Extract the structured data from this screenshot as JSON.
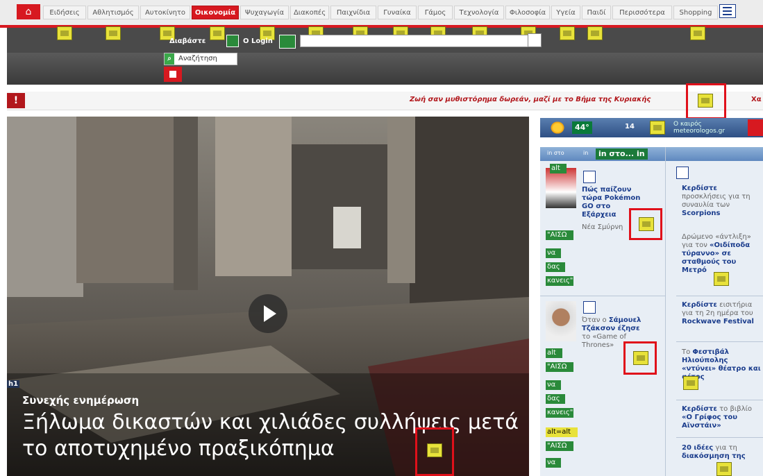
{
  "nav": {
    "home_icon": "home-icon",
    "tabs": [
      {
        "label": "Ειδήσεις"
      },
      {
        "label": "Αθλητισμός"
      },
      {
        "label": "Αυτοκίνητο"
      },
      {
        "label": "Οικονομία",
        "active": true
      },
      {
        "label": "Ψυχαγωγία"
      },
      {
        "label": "Διακοπές"
      },
      {
        "label": "Παιχνίδια"
      },
      {
        "label": "Γυναίκα"
      },
      {
        "label": "Γάμος"
      },
      {
        "label": "Τεχνολογία"
      },
      {
        "label": "Φιλοσοφία"
      },
      {
        "label": "Υγεία"
      },
      {
        "label": "Παιδί"
      },
      {
        "label": "Περισσότερα"
      },
      {
        "label": "Shopping"
      }
    ],
    "accent": "#d71920"
  },
  "toolbar": {
    "read_label": "Διαβάστε",
    "o_label": "Ο Login",
    "search_label": "Αναζήτηση"
  },
  "ticker": {
    "alert": "!",
    "text": "Ζωή σαν μυθιστόρημα δωρεάν, μαζί με το Βήμα της Κυριακής",
    "next": "Χα"
  },
  "hero": {
    "tag": "h1",
    "kicker": "Συνεχής ενημέρωση",
    "title": "Ξήλωμα δικαστών και χιλιάδες συλλήψεις μετά το αποτυχημένο πραξικόπημα"
  },
  "weather": {
    "temp_main": "44°",
    "temp_second": "14",
    "brand_top": "Ο καιρός",
    "brand_bottom": "meteorologos.gr"
  },
  "instyle": {
    "small_left": "in στο",
    "small_mid": "in",
    "title": "in στο... in"
  },
  "sidebar_left": [
    {
      "text_pre": "",
      "text_bold": "Πώς παίζουν τώρα Pokémon GO στο Εξάρχεια",
      "text_post": "",
      "source": "Νέα Σμύρνη"
    },
    {
      "text_pre": "Όταν ο ",
      "text_bold": "Σάμουελ Τζάκσον έζησε",
      "text_post": " το «Game of Thrones»",
      "source": ""
    }
  ],
  "green_labels": [
    "alt",
    "\"ΑΙΣΩ",
    "να",
    "δας",
    "κανεις\"",
    "alt=alt"
  ],
  "sidebar_right": [
    {
      "bold": "Κερδίστε",
      "rest": " προσκλήσεις για τη συναυλία των ",
      "bold2": "Scorpions"
    },
    {
      "bold": "",
      "rest": "Δρώμενο «άντλιξη» για τον ",
      "bold2": "«Οιδίποδα τύραννο» σε σταθμούς του Μετρό"
    },
    {
      "bold": "Κερδίστε",
      "rest": " εισιτήρια για τη 2η ημέρα του ",
      "bold2": "Rockwave Festival"
    },
    {
      "bold": "",
      "rest": "Το ",
      "bold2": "Φεστιβάλ Ηλιούπολης «ντύνει» θέατρο και φέτος"
    },
    {
      "bold": "Κερδίστε",
      "rest": " το βιβλίο ",
      "bold2": "«Ο Γρίφος του Αϊνστάιν»"
    },
    {
      "bold": "20 ιδέες",
      "rest": " για τη ",
      "bold2": "διακόσμηση της"
    }
  ]
}
